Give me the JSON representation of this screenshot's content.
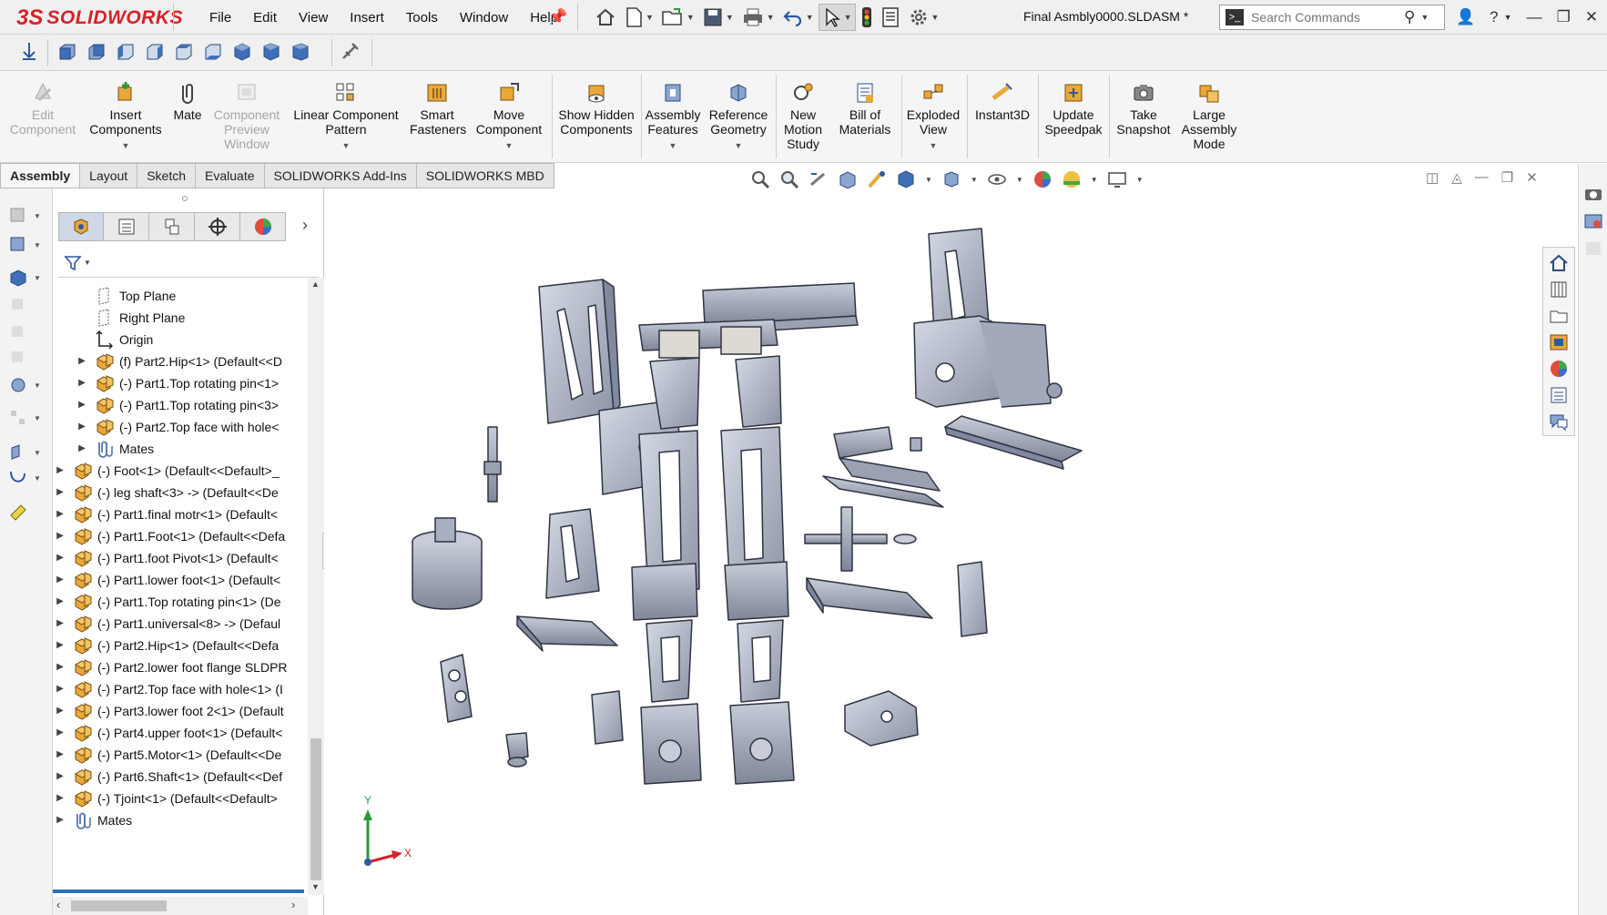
{
  "app": {
    "logo_ds": "3S",
    "logo_name": "SOLIDWORKS",
    "menus": [
      "File",
      "Edit",
      "View",
      "Insert",
      "Tools",
      "Window",
      "Help"
    ],
    "document_title": "Final Asmbly0000.SLDASM *",
    "search_placeholder": "Search Commands"
  },
  "command_manager": {
    "buttons": [
      {
        "label": "Edit Component",
        "enabled": false
      },
      {
        "label": "Insert Components",
        "enabled": true,
        "dropdown": true
      },
      {
        "label": "Mate",
        "enabled": true
      },
      {
        "label": "Component Preview Window",
        "enabled": false
      },
      {
        "label": "Linear Component Pattern",
        "enabled": true,
        "dropdown": true
      },
      {
        "label": "Smart Fasteners",
        "enabled": true
      },
      {
        "label": "Move Component",
        "enabled": true,
        "dropdown": true
      },
      {
        "label": "Show Hidden Components",
        "enabled": true
      },
      {
        "label": "Assembly Features",
        "enabled": true,
        "dropdown": true
      },
      {
        "label": "Reference Geometry",
        "enabled": true,
        "dropdown": true
      },
      {
        "label": "New Motion Study",
        "enabled": true
      },
      {
        "label": "Bill of Materials",
        "enabled": true
      },
      {
        "label": "Exploded View",
        "enabled": true,
        "dropdown": true
      },
      {
        "label": "Instant3D",
        "enabled": true
      },
      {
        "label": "Update Speedpak",
        "enabled": true
      },
      {
        "label": "Take Snapshot",
        "enabled": true
      },
      {
        "label": "Large Assembly Mode",
        "enabled": true
      }
    ]
  },
  "tabs": [
    "Assembly",
    "Layout",
    "Sketch",
    "Evaluate",
    "SOLIDWORKS Add-Ins",
    "SOLIDWORKS MBD"
  ],
  "active_tab": "Assembly",
  "feature_tree": [
    {
      "label": "Top Plane",
      "type": "plane",
      "indent": 1,
      "expandable": false
    },
    {
      "label": "Right Plane",
      "type": "plane",
      "indent": 1,
      "expandable": false
    },
    {
      "label": "Origin",
      "type": "origin",
      "indent": 1,
      "expandable": false
    },
    {
      "label": "(f) Part2.Hip<1> (Default<<D",
      "type": "part",
      "indent": 1,
      "expandable": true
    },
    {
      "label": "(-) Part1.Top rotating pin<1>",
      "type": "part",
      "indent": 1,
      "expandable": true
    },
    {
      "label": "(-) Part1.Top rotating pin<3>",
      "type": "part",
      "indent": 1,
      "expandable": true
    },
    {
      "label": "(-) Part2.Top face with hole<",
      "type": "part",
      "indent": 1,
      "expandable": true
    },
    {
      "label": "Mates",
      "type": "mates",
      "indent": 1,
      "expandable": true
    },
    {
      "label": "(-) Foot<1> (Default<<Default>_",
      "type": "part",
      "indent": 0,
      "expandable": true
    },
    {
      "label": "(-) leg shaft<3> -> (Default<<De",
      "type": "part",
      "indent": 0,
      "expandable": true
    },
    {
      "label": "(-) Part1.final motr<1> (Default<",
      "type": "part",
      "indent": 0,
      "expandable": true
    },
    {
      "label": "(-) Part1.Foot<1> (Default<<Defa",
      "type": "part",
      "indent": 0,
      "expandable": true
    },
    {
      "label": "(-) Part1.foot Pivot<1> (Default<",
      "type": "part",
      "indent": 0,
      "expandable": true
    },
    {
      "label": "(-) Part1.lower foot<1> (Default<",
      "type": "part",
      "indent": 0,
      "expandable": true
    },
    {
      "label": "(-) Part1.Top rotating pin<1> (De",
      "type": "part",
      "indent": 0,
      "expandable": true
    },
    {
      "label": "(-) Part1.universal<8> -> (Defaul",
      "type": "part",
      "indent": 0,
      "expandable": true
    },
    {
      "label": "(-) Part2.Hip<1> (Default<<Defa",
      "type": "part",
      "indent": 0,
      "expandable": true
    },
    {
      "label": "(-) Part2.lower foot flange SLDPR",
      "type": "part",
      "indent": 0,
      "expandable": true
    },
    {
      "label": "(-) Part2.Top face with hole<1> (I",
      "type": "part",
      "indent": 0,
      "expandable": true
    },
    {
      "label": "(-) Part3.lower foot 2<1> (Default",
      "type": "part",
      "indent": 0,
      "expandable": true
    },
    {
      "label": "(-) Part4.upper foot<1> (Default<",
      "type": "part",
      "indent": 0,
      "expandable": true
    },
    {
      "label": "(-) Part5.Motor<1> (Default<<De",
      "type": "part",
      "indent": 0,
      "expandable": true
    },
    {
      "label": "(-) Part6.Shaft<1> (Default<<Def",
      "type": "part",
      "indent": 0,
      "expandable": true
    },
    {
      "label": "(-) Tjoint<1> (Default<<Default>",
      "type": "part",
      "indent": 0,
      "expandable": true
    },
    {
      "label": "Mates",
      "type": "mates",
      "indent": 0,
      "expandable": true
    }
  ],
  "triad": {
    "y_label": "Y",
    "x_label": "X"
  },
  "colors": {
    "brand": "#d4222a",
    "part_icon": "#e8a83a",
    "part_fill": "#b5bccb",
    "part_edge": "#2f3340",
    "selection_blue": "#2c6fb7"
  }
}
